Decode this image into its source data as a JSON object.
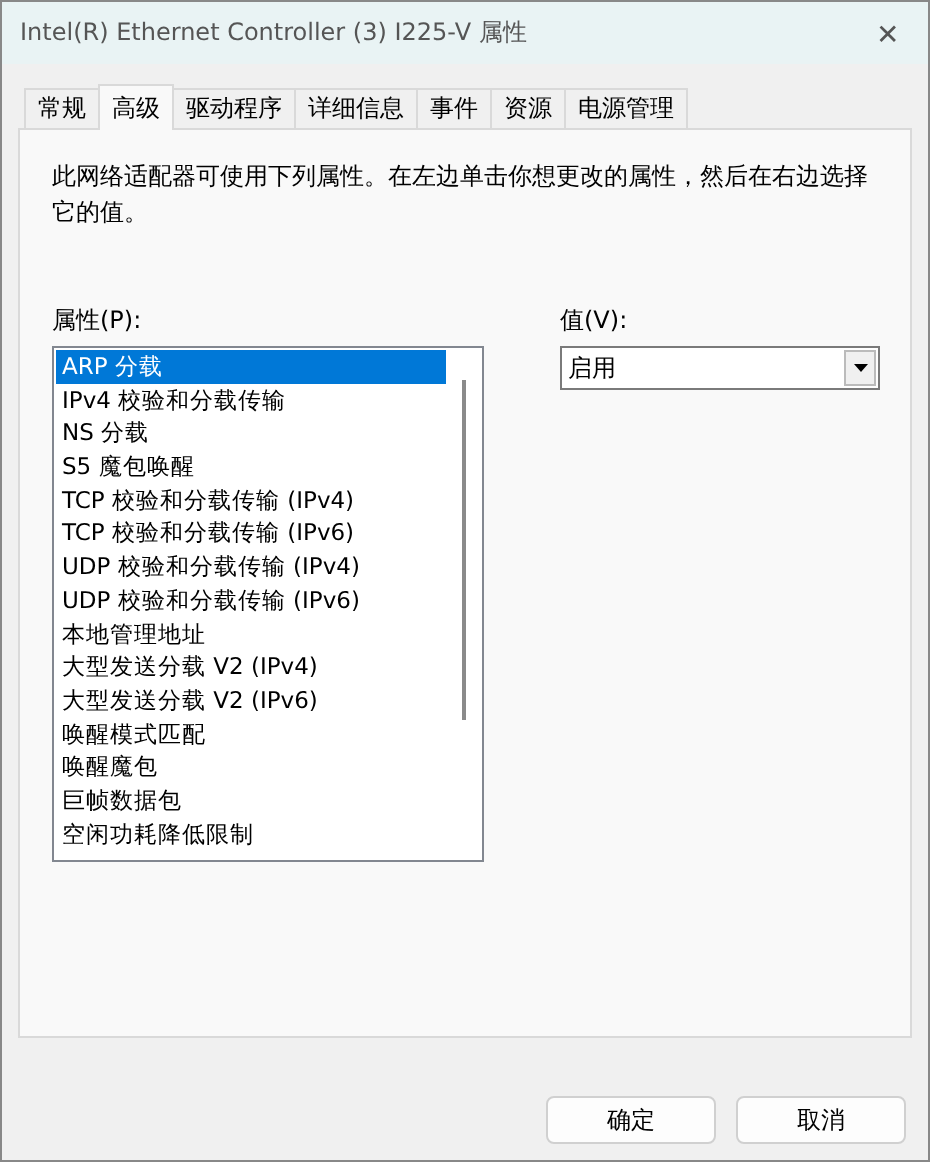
{
  "window": {
    "title": "Intel(R) Ethernet Controller (3) I225-V 属性",
    "close": "✕"
  },
  "tabs": [
    {
      "label": "常规",
      "selected": false
    },
    {
      "label": "高级",
      "selected": true
    },
    {
      "label": "驱动程序",
      "selected": false
    },
    {
      "label": "详细信息",
      "selected": false
    },
    {
      "label": "事件",
      "selected": false
    },
    {
      "label": "资源",
      "selected": false
    },
    {
      "label": "电源管理",
      "selected": false
    }
  ],
  "description": "此网络适配器可使用下列属性。在左边单击你想更改的属性，然后在右边选择它的值。",
  "properties": {
    "label": "属性(P):",
    "items": [
      {
        "label": "ARP 分载",
        "selected": true
      },
      {
        "label": "IPv4 校验和分载传输",
        "selected": false
      },
      {
        "label": "NS 分载",
        "selected": false
      },
      {
        "label": "S5 魔包唤醒",
        "selected": false
      },
      {
        "label": "TCP 校验和分载传输 (IPv4)",
        "selected": false
      },
      {
        "label": "TCP 校验和分载传输 (IPv6)",
        "selected": false
      },
      {
        "label": "UDP 校验和分载传输 (IPv4)",
        "selected": false
      },
      {
        "label": "UDP 校验和分载传输 (IPv6)",
        "selected": false
      },
      {
        "label": "本地管理地址",
        "selected": false
      },
      {
        "label": "大型发送分载 V2 (IPv4)",
        "selected": false
      },
      {
        "label": "大型发送分载 V2 (IPv6)",
        "selected": false
      },
      {
        "label": "唤醒模式匹配",
        "selected": false
      },
      {
        "label": "唤醒魔包",
        "selected": false
      },
      {
        "label": "巨帧数据包",
        "selected": false
      },
      {
        "label": "空闲功耗降低限制",
        "selected": false
      }
    ]
  },
  "value": {
    "label": "值(V):",
    "selected": "启用"
  },
  "buttons": [
    "确定",
    "取消"
  ]
}
